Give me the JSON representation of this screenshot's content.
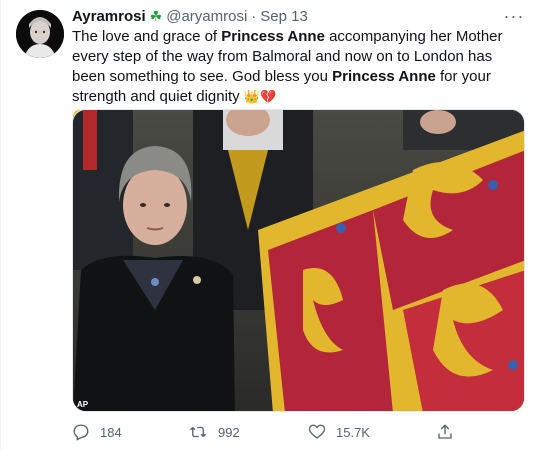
{
  "tweet": {
    "author_name": "Ayramrosi",
    "name_emoji": "☘",
    "handle": "@aryamrosi",
    "dot": "·",
    "date": "Sep 13",
    "more_label": "···",
    "text_segments": [
      {
        "t": "The love and grace of ",
        "b": false
      },
      {
        "t": "Princess Anne",
        "b": true
      },
      {
        "t": " accompanying her Mother every step of the way from Balmoral and now on to London has been something to see. God bless you ",
        "b": false
      },
      {
        "t": "Princess Anne",
        "b": true
      },
      {
        "t": " for your strength and quiet dignity ",
        "b": false
      }
    ],
    "trailing_emojis": [
      "👑",
      "💔",
      "🥲"
    ],
    "media_credit": "AP",
    "actions": {
      "replies": "184",
      "retweets": "992",
      "likes": "15.7K"
    }
  },
  "colors": {
    "text": "#0f1419",
    "secondary": "#536471",
    "flag_red": "#b3263a",
    "flag_gold": "#e3b72d"
  },
  "icons": [
    "reply-icon",
    "retweet-icon",
    "like-icon",
    "share-icon",
    "more-icon"
  ]
}
